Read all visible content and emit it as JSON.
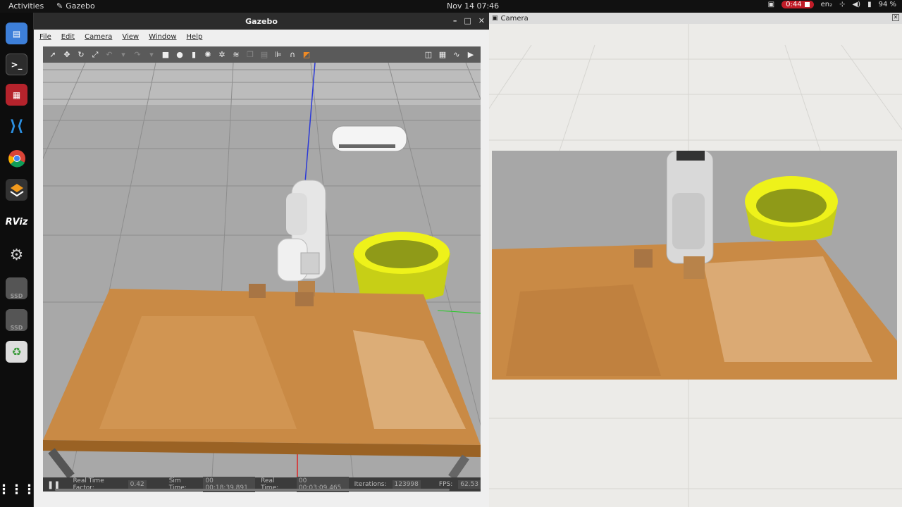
{
  "topbar": {
    "activities": "Activities",
    "app_name": "Gazebo",
    "clock": "Nov 14  07:46",
    "recording": "0:44",
    "lang": "en₂",
    "battery": "94 %"
  },
  "dock": {
    "rviz_label": "RViz",
    "ssd1": "SSD",
    "ssd2": "SSD"
  },
  "gazebo": {
    "title": "Gazebo",
    "menu": {
      "file": "File",
      "edit": "Edit",
      "camera": "Camera",
      "view": "View",
      "window": "Window",
      "help": "Help"
    },
    "status": {
      "rtf_label": "Real Time Factor:",
      "rtf_value": "0.42",
      "sim_label": "Sim Time:",
      "sim_value": "00 00:18:39.891",
      "real_label": "Real Time:",
      "real_value": "00 00:03:09.465",
      "iter_label": "Iterations:",
      "iter_value": "123998",
      "fps_label": "FPS:",
      "fps_value": "62.53"
    }
  },
  "camera_window": {
    "title": "Camera"
  },
  "colors": {
    "table_wood": "#c98a45",
    "bin_yellow": "#e8ec1a",
    "ground_grey": "#a7a7a7",
    "robot_white": "#e6e6e6"
  }
}
